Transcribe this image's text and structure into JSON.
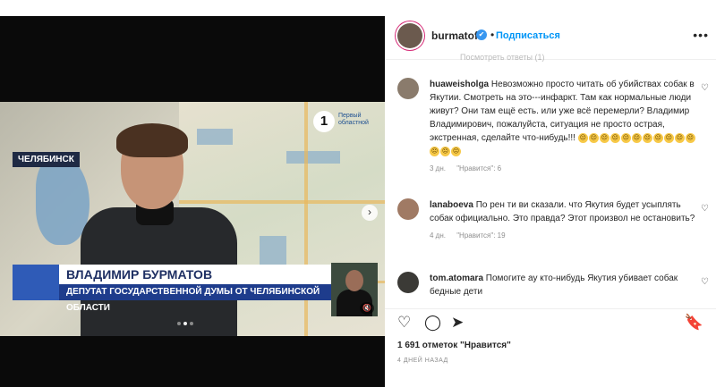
{
  "post": {
    "username": "burmatoff",
    "follow_label": "Подписаться",
    "separator": "•",
    "verified_glyph": "✔",
    "more_glyph": "•••",
    "faded_text": "Посмотреть ответы (1)",
    "likes_text": "1 691 отметок \"Нравится\"",
    "date_text": "4 ДНЕЙ НАЗАД"
  },
  "video": {
    "city_tag": "ЧЕЛЯБИНСК",
    "channel_logo_glyph": "1",
    "channel_name": "Первый областной",
    "name_caption": "ВЛАДИМИР БУРМАТОВ",
    "title_caption": "ДЕПУТАТ ГОСУДАРСТВЕННОЙ ДУМЫ ОТ ЧЕЛЯБИНСКОЙ ОБЛАСТИ",
    "next_glyph": "›",
    "mute_glyph": "🔇",
    "carousel_dots": 3,
    "carousel_active": 1
  },
  "comments": [
    {
      "username": "huaweisholga",
      "text": "Невозможно просто читать об убийствах собак в Якутии. Смотреть на это---инфаркт. Там как нормальные люди живут? Они там ещё есть. или уже всё перемерли? Владимир Владимирович, пожалуйста, ситуация не просто острая, экстренная, сделайте что-нибудь!!!",
      "emoji_count": 14,
      "emoji_glyph": "☹",
      "age": "3 дн.",
      "likes": "\"Нравится\": 6",
      "heart": "♡"
    },
    {
      "username": "lanaboeva",
      "text": "По рен ти ви сказали. что Якутия будет усыплять собак официально. Это правда? Этот произвол не остановить?",
      "age": "4 дн.",
      "likes": "\"Нравится\": 19",
      "heart": "♡"
    },
    {
      "username": "tom.atomara",
      "text": "Помогите ау кто-нибудь Якутия убивает собак бедные дети",
      "heart": "♡"
    }
  ],
  "icons": {
    "like": "♡",
    "comment": "◯",
    "share": "➤",
    "save": "🔖"
  },
  "colors": {
    "follow_blue": "#0095f6",
    "caption_blue": "#1e3c8c"
  }
}
